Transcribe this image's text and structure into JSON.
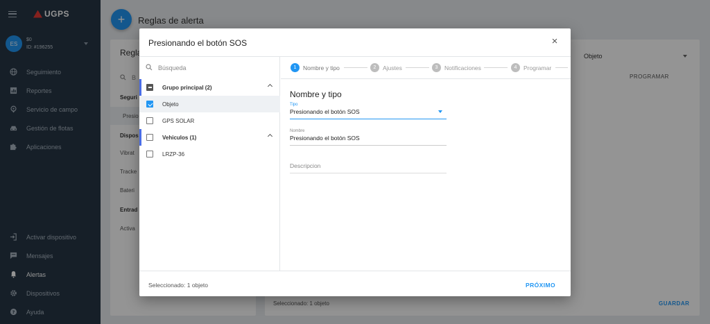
{
  "sidebar": {
    "logo": "UGPS",
    "user": {
      "initials": "ES",
      "name": "$0",
      "id": "ID: #196255"
    },
    "nav_top": [
      {
        "label": "Seguimiento",
        "icon": "globe-icon"
      },
      {
        "label": "Reportes",
        "icon": "chart-icon"
      },
      {
        "label": "Servicio de campo",
        "icon": "location-pin-icon"
      },
      {
        "label": "Gestión de flotas",
        "icon": "car-icon"
      },
      {
        "label": "Aplicaciones",
        "icon": "puzzle-icon"
      }
    ],
    "nav_bottom": [
      {
        "label": "Activar dispositivo",
        "icon": "login-icon"
      },
      {
        "label": "Mensajes",
        "icon": "message-icon"
      },
      {
        "label": "Alertas",
        "icon": "bell-icon",
        "active": true
      },
      {
        "label": "Dispositivos",
        "icon": "gear-icon"
      },
      {
        "label": "Ayuda",
        "icon": "help-icon"
      }
    ]
  },
  "page": {
    "fab_label": "+",
    "title": "Reglas de alerta"
  },
  "bg_left": {
    "title": "Regla",
    "search": "B",
    "rows": [
      "Seguri",
      "Presio",
      "Dispos",
      "Vibrat",
      "Tracke",
      "Bateri",
      "Entrad",
      "Activa"
    ]
  },
  "bg_right": {
    "select_value": "Objeto",
    "column": "PROGRAMAR",
    "footer": "Seleccionado: 1 objeto",
    "save": "GUARDAR"
  },
  "dialog": {
    "title": "Presionando el botón SOS",
    "close": "×",
    "search_placeholder": "Búsqueda",
    "tree": [
      {
        "label": "Grupo principal (2)",
        "type": "group",
        "state": "indeterminate"
      },
      {
        "label": "Objeto",
        "type": "item",
        "state": "checked"
      },
      {
        "label": "GPS SOLAR",
        "type": "item",
        "state": "unchecked"
      },
      {
        "label": "Vehiculos (1)",
        "type": "group",
        "state": "unchecked"
      },
      {
        "label": "LRZP-36",
        "type": "item",
        "state": "unchecked"
      }
    ],
    "steps": [
      {
        "num": "1",
        "label": "Nombre y tipo",
        "active": true
      },
      {
        "num": "2",
        "label": "Ajustes"
      },
      {
        "num": "3",
        "label": "Notificaciones"
      },
      {
        "num": "4",
        "label": "Programar"
      }
    ],
    "form": {
      "title": "Nombre y tipo",
      "tipo_label": "Tipo",
      "tipo_value": "Presionando el botón SOS",
      "nombre_label": "Nombre",
      "nombre_value": "Presionando el botón SOS",
      "descripcion_placeholder": "Descripcion"
    },
    "footer": {
      "selected": "Seleccionado: 1 objeto",
      "next": "PRÓXIMO"
    }
  },
  "colors": {
    "accent": "#2196f3",
    "sidebar": "#263645",
    "alert_red": "#e53935"
  }
}
